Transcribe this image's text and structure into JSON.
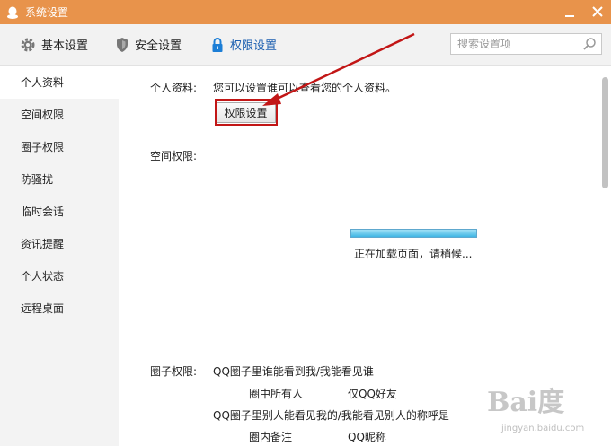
{
  "window": {
    "title": "系统设置"
  },
  "toolbar": {
    "tabs": [
      {
        "label": "基本设置",
        "icon": "gear-icon"
      },
      {
        "label": "安全设置",
        "icon": "shield-icon"
      },
      {
        "label": "权限设置",
        "icon": "lock-icon",
        "active": true
      }
    ],
    "search_placeholder": "搜索设置项"
  },
  "sidebar": {
    "items": [
      {
        "label": "个人资料",
        "active": true
      },
      {
        "label": "空间权限"
      },
      {
        "label": "圈子权限"
      },
      {
        "label": "防骚扰"
      },
      {
        "label": "临时会话"
      },
      {
        "label": "资讯提醒"
      },
      {
        "label": "个人状态"
      },
      {
        "label": "远程桌面"
      }
    ]
  },
  "main": {
    "profile": {
      "label": "个人资料:",
      "description": "您可以设置谁可以查看您的个人资料。",
      "button_label": "权限设置"
    },
    "space": {
      "label": "空间权限:",
      "loading_text": "正在加载页面，请稍候..."
    },
    "circle": {
      "label": "圈子权限:",
      "question1": "QQ圈子里谁能看到我/我能看见谁",
      "option1a": "圈中所有人",
      "option1b": "仅QQ好友",
      "question2": "QQ圈子里别人能看见我的/我能看见别人的称呼是",
      "option2a": "圈内备注",
      "option2b": "QQ昵称"
    }
  },
  "colors": {
    "titlebar": "#e8934b",
    "active_tab": "#1c5fb0",
    "annotation": "#c21616",
    "progress": "#3fb6e4"
  },
  "watermark": {
    "brand": "Bai度",
    "sub": "jingyan.baidu.com"
  }
}
